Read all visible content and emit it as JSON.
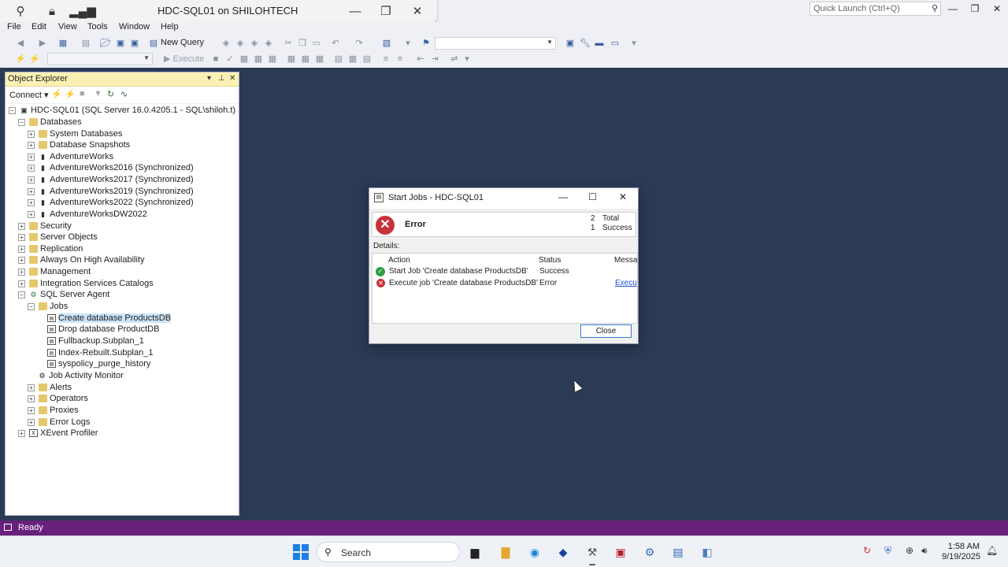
{
  "window": {
    "remote_title": "HDC-SQL01 on SHILOHTECH",
    "quick_launch_placeholder": "Quick Launch (Ctrl+Q)"
  },
  "menu": [
    "File",
    "Edit",
    "View",
    "Tools",
    "Window",
    "Help"
  ],
  "toolbar": {
    "new_query": "New Query",
    "execute": "Execute"
  },
  "object_explorer": {
    "title": "Object Explorer",
    "connect": "Connect",
    "server": "HDC-SQL01 (SQL Server 16.0.4205.1 - SQL\\shiloh.t)",
    "databases": "Databases",
    "db_items": [
      "System Databases",
      "Database Snapshots",
      "AdventureWorks",
      "AdventureWorks2016 (Synchronized)",
      "AdventureWorks2017 (Synchronized)",
      "AdventureWorks2019 (Synchronized)",
      "AdventureWorks2022 (Synchronized)",
      "AdventureWorksDW2022"
    ],
    "top_items": [
      "Security",
      "Server Objects",
      "Replication",
      "Always On High Availability",
      "Management",
      "Integration Services Catalogs"
    ],
    "agent": "SQL Server Agent",
    "jobs": "Jobs",
    "job_items": [
      "Create database ProductsDB",
      "Drop database ProductDB",
      "Fullbackup.Subplan_1",
      "Index-Rebuilt.Subplan_1",
      "syspolicy_purge_history"
    ],
    "job_activity_monitor": "Job Activity Monitor",
    "agent_items": [
      "Alerts",
      "Operators",
      "Proxies",
      "Error Logs"
    ],
    "xevent": "XEvent Profiler"
  },
  "dialog": {
    "title": "Start Jobs - HDC-SQL01",
    "status": "Error",
    "total_count": "2",
    "total_label": "Total",
    "success_count": "1",
    "success_label": "Success",
    "details_label": "Details:",
    "columns": [
      "Action",
      "Status",
      "Messag"
    ],
    "rows": [
      {
        "action": "Start Job 'Create database ProductsDB'",
        "status": "Success",
        "message": "",
        "result": "success"
      },
      {
        "action": "Execute job 'Create database ProductsDB'",
        "status": "Error",
        "message": "Execut",
        "result": "error"
      }
    ],
    "close_label": "Close"
  },
  "status_bar": {
    "text": "Ready",
    "color": "#68217a"
  },
  "taskbar": {
    "search_label": "Search",
    "time": "1:58 AM",
    "date": "9/19/2025"
  }
}
